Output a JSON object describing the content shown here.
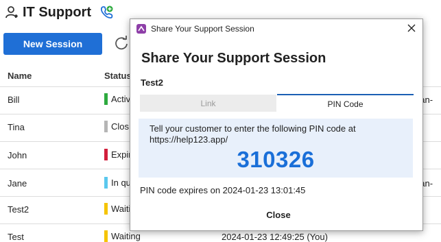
{
  "header": {
    "title": "IT Support",
    "user_icon": "user-gear-icon",
    "logo_icon": "support-logo-icon"
  },
  "toolbar": {
    "new_session_label": "New Session",
    "refresh_icon": "refresh-icon"
  },
  "table": {
    "columns": [
      "Name",
      "Status"
    ],
    "rows": [
      {
        "name": "Bill",
        "status": "Active",
        "status_color": "#2eaa3f",
        "extra": "gan-"
      },
      {
        "name": "Tina",
        "status": "Clos",
        "status_color": "#b5b5b5",
        "extra": ""
      },
      {
        "name": "John",
        "status": "Expir",
        "status_color": "#d21f3c",
        "extra": ""
      },
      {
        "name": "Jane",
        "status": "In qu",
        "status_color": "#5bc8ee",
        "extra": "gan-"
      },
      {
        "name": "Test2",
        "status": "Waiti",
        "status_color": "#f5c400",
        "extra": ""
      },
      {
        "name": "Test",
        "status": "Waiting",
        "status_color": "#f5c400",
        "extra": ""
      }
    ],
    "partial_timestamp": "2024-01-23 12:49:25 (You)"
  },
  "modal": {
    "window_title": "Share Your Support Session",
    "heading": "Share Your Support Session",
    "session_name": "Test2",
    "tabs": {
      "link": "Link",
      "pin": "PIN Code"
    },
    "instruction": "Tell your customer to enter the following PIN code at https://help123.app/",
    "pin": "310326",
    "expiry": "PIN code expires on 2024-01-23 13:01:45",
    "close_label": "Close"
  },
  "colors": {
    "accent": "#1f6fd6",
    "pin_color": "#1a6fd8",
    "pin_box_bg": "#e8f0fb"
  }
}
